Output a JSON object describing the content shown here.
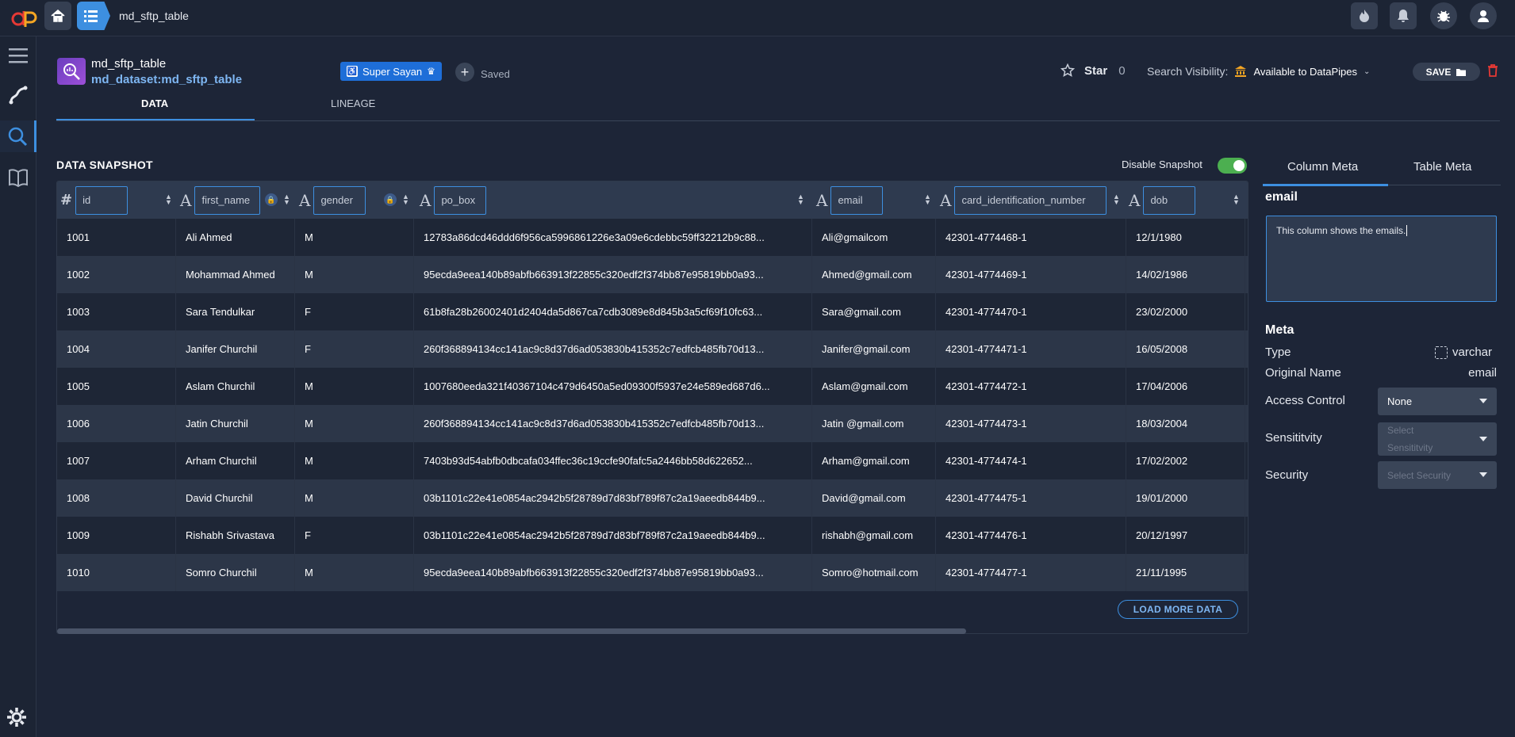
{
  "topbar": {
    "breadcrumb": "md_sftp_table",
    "icons": [
      "logo-icon",
      "home-icon",
      "list-icon",
      "fire-icon",
      "bell-icon",
      "bug-icon",
      "user-icon"
    ]
  },
  "sidebar": {
    "icons": [
      "menu-icon",
      "lineage-icon",
      "search-icon",
      "book-icon",
      "gear-icon"
    ]
  },
  "header": {
    "name": "md_sftp_table",
    "urn": "md_dataset:md_sftp_table",
    "tag_label": "Super Sayan",
    "saved_label": "Saved",
    "star_label": "Star",
    "star_count": "0",
    "visibility_label": "Search Visibility:",
    "visibility_value": "Available to DataPipes",
    "save_label": "SAVE"
  },
  "tabs": [
    {
      "label": "DATA",
      "active": true
    },
    {
      "label": "LINEAGE",
      "active": false
    }
  ],
  "snapshot": {
    "title": "DATA SNAPSHOT",
    "disable_label": "Disable Snapshot",
    "toggle_on": true,
    "load_more_label": "LOAD MORE DATA"
  },
  "table": {
    "columns": [
      {
        "type": "#",
        "name": "id"
      },
      {
        "type": "A",
        "name": "first_name"
      },
      {
        "type": "A",
        "name": "gender"
      },
      {
        "type": "A",
        "name": "po_box"
      },
      {
        "type": "A",
        "name": "email"
      },
      {
        "type": "A",
        "name": "card_identification_number"
      },
      {
        "type": "A",
        "name": "dob"
      }
    ],
    "rows": [
      [
        "1001",
        "Ali Ahmed",
        "M",
        "12783a86dcd46ddd6f956ca5996861226e3a09e6cdebbc59ff32212b9c88...",
        "Ali@gmailcom",
        "42301-4774468-1",
        "12/1/1980"
      ],
      [
        "1002",
        "Mohammad Ahmed",
        "M",
        "95ecda9eea140b89abfb663913f22855c320edf2f374bb87e95819bb0a93...",
        "Ahmed@gmail.com",
        "42301-4774469-1",
        "14/02/1986"
      ],
      [
        "1003",
        "Sara Tendulkar",
        "F",
        "61b8fa28b26002401d2404da5d867ca7cdb3089e8d845b3a5cf69f10fc63...",
        "Sara@gmail.com",
        "42301-4774470-1",
        "23/02/2000"
      ],
      [
        "1004",
        "Janifer Churchil",
        "F",
        "260f368894134cc141ac9c8d37d6ad053830b415352c7edfcb485fb70d13...",
        "Janifer@gmail.com",
        "42301-4774471-1",
        "16/05/2008"
      ],
      [
        "1005",
        "Aslam Churchil",
        "M",
        "1007680eeda321f40367104c479d6450a5ed09300f5937e24e589ed687d6...",
        "Aslam@gmail.com",
        "42301-4774472-1",
        "17/04/2006"
      ],
      [
        "1006",
        "Jatin Churchil",
        "M",
        "260f368894134cc141ac9c8d37d6ad053830b415352c7edfcb485fb70d13...",
        "Jatin @gmail.com",
        "42301-4774473-1",
        "18/03/2004"
      ],
      [
        "1007",
        "Arham Churchil",
        "M",
        "7403b93d54abfb0dbcafa034ffec36c19ccfe90fafc5a2446bb58d622652...",
        "Arham@gmail.com",
        "42301-4774474-1",
        "17/02/2002"
      ],
      [
        "1008",
        "David Churchil",
        "M",
        "03b1101c22e41e0854ac2942b5f28789d7d83bf789f87c2a19aeedb844b9...",
        "David@gmail.com",
        "42301-4774475-1",
        "19/01/2000"
      ],
      [
        "1009",
        "Rishabh Srivastava",
        "F",
        "03b1101c22e41e0854ac2942b5f28789d7d83bf789f87c2a19aeedb844b9...",
        "rishabh@gmail.com",
        "42301-4774476-1",
        "20/12/1997"
      ],
      [
        "1010",
        "Somro Churchil",
        "M",
        "95ecda9eea140b89abfb663913f22855c320edf2f374bb87e95819bb0a93...",
        "Somro@hotmail.com",
        "42301-4774477-1",
        "21/11/1995"
      ]
    ]
  },
  "right_panel": {
    "tabs": [
      "Column Meta",
      "Table Meta"
    ],
    "column_name": "email",
    "description": "This column shows the emails.",
    "meta_title": "Meta",
    "type_label": "Type",
    "type_value": "varchar",
    "original_name_label": "Original Name",
    "original_name_value": "email",
    "access_control_label": "Access Control",
    "access_control_value": "None",
    "sensitivity_label": "Sensititvity",
    "sensitivity_placeholder_1": "Select",
    "sensitivity_placeholder_2": "Sensititvity",
    "security_label": "Security",
    "security_placeholder": "Select Security"
  },
  "colors": {
    "accent": "#3d8fe0",
    "background": "#1d2537",
    "toggle_on": "#4caf50",
    "delete": "#e53935",
    "tag": "#1e6ed8"
  }
}
